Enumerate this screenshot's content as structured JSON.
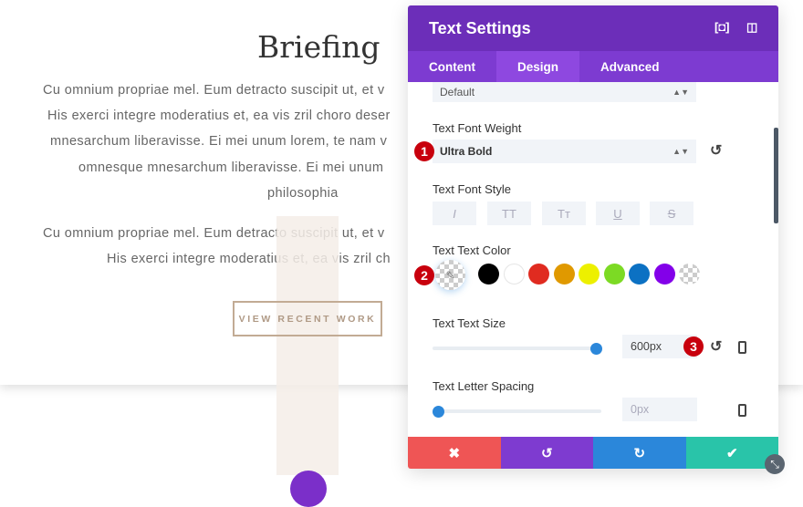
{
  "background": {
    "title": "Briefing",
    "lines": [
      "Cu omnium propriae mel. Eum detracto suscipit ut, et v",
      "His exerci integre moderatius et, ea vis zril choro deser",
      "mnesarchum liberavisse. Ei mei unum lorem, te nam v",
      "omnesque mnesarchum liberavisse. Ei mei unum",
      "philosophia",
      "Cu omnium propriae mel. Eum detracto suscipit ut, et v",
      "His exerci integre moderatius et, ea vis zril ch"
    ],
    "cta": "VIEW RECENT WORK"
  },
  "panel": {
    "title": "Text Settings",
    "tabs": [
      "Content",
      "Design",
      "Advanced"
    ],
    "active_tab": "Design",
    "font_select": "Default",
    "font_weight_label": "Text Font Weight",
    "font_weight": "Ultra Bold",
    "font_style_label": "Text Font Style",
    "font_styles": [
      "I",
      "TT",
      "Tт",
      "U",
      "S"
    ],
    "text_color_label": "Text Text Color",
    "swatches": [
      "#000000",
      "#ffffff",
      "#e02b20",
      "#e09900",
      "#edf000",
      "#7cda24",
      "#0c71c3",
      "#8300e9"
    ],
    "text_size_label": "Text Text Size",
    "text_size": "600px",
    "text_size_fraction": 0.97,
    "letter_spacing_label": "Text Letter Spacing",
    "letter_spacing": "0px",
    "letter_spacing_fraction": 0,
    "badges": [
      "1",
      "2",
      "3"
    ],
    "footer_colors": {
      "cancel": "#ef5555",
      "undo": "#7e3bd0",
      "redo": "#2b87da",
      "save": "#29c4a9"
    }
  }
}
